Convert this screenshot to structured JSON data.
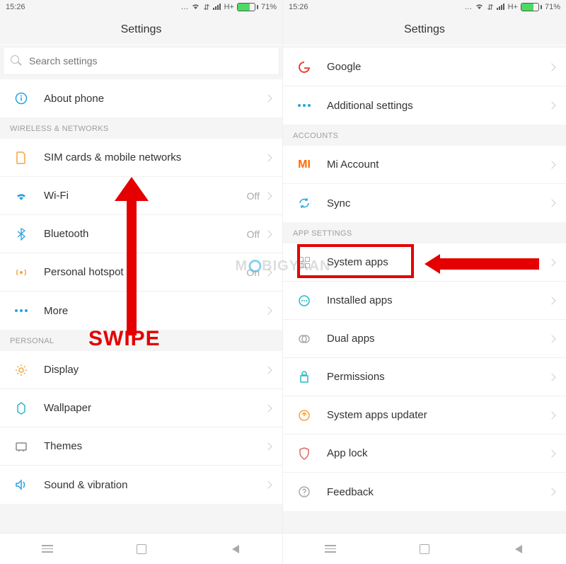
{
  "status": {
    "time": "15:26",
    "signal": "H+",
    "battery_pct": "71%"
  },
  "left": {
    "title": "Settings",
    "search_placeholder": "Search settings",
    "top": {
      "about": "About phone"
    },
    "sec_wireless": "WIRELESS & NETWORKS",
    "wireless": {
      "sim": "SIM cards & mobile networks",
      "wifi": "Wi-Fi",
      "wifi_val": "Off",
      "bt": "Bluetooth",
      "bt_val": "Off",
      "hotspot": "Personal hotspot",
      "hotspot_val": "On",
      "more": "More"
    },
    "sec_personal": "PERSONAL",
    "personal": {
      "display": "Display",
      "wallpaper": "Wallpaper",
      "themes": "Themes",
      "sound": "Sound & vibration"
    }
  },
  "right": {
    "title": "Settings",
    "top": {
      "google": "Google",
      "additional": "Additional settings"
    },
    "sec_accounts": "ACCOUNTS",
    "accounts": {
      "mi": "Mi Account",
      "sync": "Sync"
    },
    "sec_app": "APP SETTINGS",
    "app": {
      "system_apps": "System apps",
      "installed": "Installed apps",
      "dual": "Dual apps",
      "permissions": "Permissions",
      "updater": "System apps updater",
      "lock": "App lock",
      "feedback": "Feedback"
    }
  },
  "annotations": {
    "swipe": "SWIPE",
    "watermark": "M BIGYAAN"
  },
  "icons": {
    "info": "info-icon",
    "sim": "sim-icon",
    "wifi": "wifi-icon",
    "bt": "bluetooth-icon",
    "hotspot": "hotspot-icon",
    "more": "more-dots-icon",
    "display": "display-icon",
    "wallpaper": "wallpaper-icon",
    "themes": "themes-icon",
    "sound": "sound-icon",
    "google": "google-g-icon",
    "additional": "more-dots-icon",
    "mi": "mi-logo-icon",
    "sync": "sync-icon",
    "grid": "apps-grid-icon",
    "installed": "installed-apps-icon",
    "dual": "dual-apps-icon",
    "permissions": "permissions-icon",
    "updater": "update-icon",
    "lock": "lock-shield-icon",
    "feedback": "feedback-icon"
  }
}
